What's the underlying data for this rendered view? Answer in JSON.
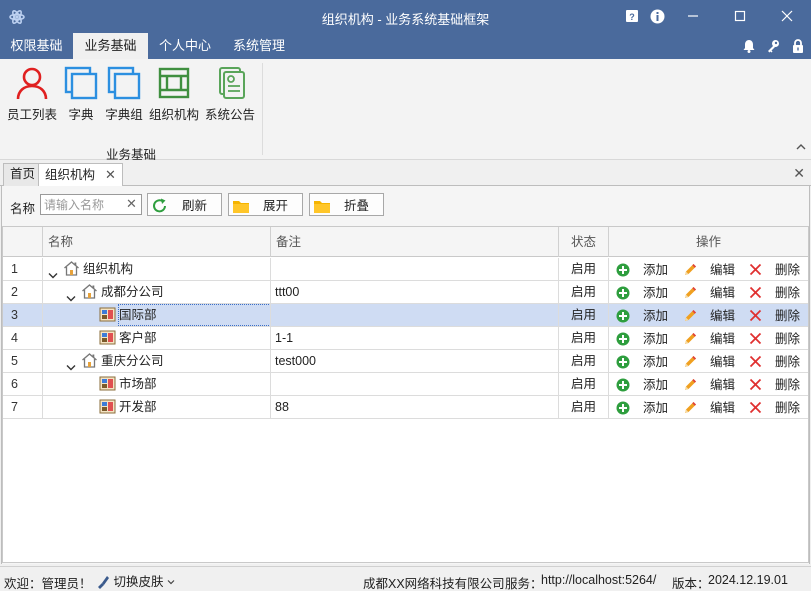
{
  "window": {
    "title": "组织机构 - 业务系统基础框架"
  },
  "menu": {
    "tabs": [
      "权限基础",
      "业务基础",
      "个人中心",
      "系统管理"
    ],
    "active_index": 1
  },
  "ribbon": {
    "buttons": [
      "员工列表",
      "字典",
      "字典组",
      "组织机构",
      "系统公告"
    ],
    "group_label": "业务基础"
  },
  "doc_tabs": {
    "home": "首页",
    "current": "组织机构"
  },
  "toolbar": {
    "name_label": "名称",
    "search_placeholder": "请输入名称",
    "refresh": "刷新",
    "expand": "展开",
    "collapse": "折叠"
  },
  "grid": {
    "columns": [
      "名称",
      "备注",
      "状态",
      "操作"
    ],
    "rows": [
      {
        "num": "1",
        "name": "组织机构",
        "remark": "",
        "status": "启用",
        "level": 0,
        "type": "home",
        "expanded": true
      },
      {
        "num": "2",
        "name": "成都分公司",
        "remark": "ttt00",
        "status": "启用",
        "level": 1,
        "type": "home",
        "expanded": true
      },
      {
        "num": "3",
        "name": "国际部",
        "remark": "",
        "status": "启用",
        "level": 2,
        "type": "dept",
        "selected": true
      },
      {
        "num": "4",
        "name": "客户部",
        "remark": "1-1",
        "status": "启用",
        "level": 2,
        "type": "dept"
      },
      {
        "num": "5",
        "name": "重庆分公司",
        "remark": "test000",
        "status": "启用",
        "level": 1,
        "type": "home",
        "expanded": true
      },
      {
        "num": "6",
        "name": "市场部",
        "remark": "",
        "status": "启用",
        "level": 2,
        "type": "dept"
      },
      {
        "num": "7",
        "name": "开发部",
        "remark": "88",
        "status": "启用",
        "level": 2,
        "type": "dept"
      }
    ],
    "ops": {
      "add": "添加",
      "edit": "编辑",
      "delete": "删除"
    }
  },
  "statusbar": {
    "welcome": "欢迎：管理员！",
    "skin": "切换皮肤",
    "company": "成都XX网络科技有限公司",
    "service_label": "服务：",
    "service_url": "http://localhost:5264/",
    "version_label": "版本：",
    "version": "2024.12.19.01"
  },
  "colors": {
    "titlebar": "#4a6a9c",
    "ribbon_icon_blue": "#2c8fe0",
    "user_icon_red": "#e02020",
    "add_green": "#2e9e3e",
    "delete_red": "#e03030",
    "selected_row": "#cfdcf3"
  }
}
